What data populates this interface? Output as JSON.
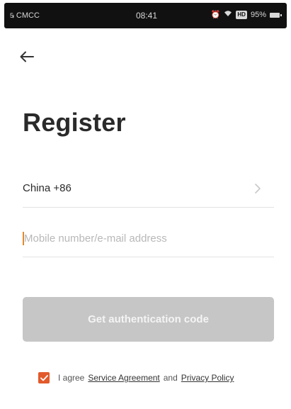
{
  "status_bar": {
    "carrier": "CMCC",
    "time": "08:41",
    "battery": "95%"
  },
  "register": {
    "title": "Register",
    "country": "China +86",
    "account_placeholder": "Mobile number/e-mail address",
    "account_value": "",
    "auth_button_label": "Get authentication code",
    "agree_prefix": "I agree",
    "service_agreement": "Service Agreement",
    "and": "and",
    "privacy_policy": "Privacy Policy",
    "agreed": true
  },
  "colors": {
    "accent": "#e25a2b",
    "disabled_button": "#c6c6c6",
    "caret": "#e08a2c"
  },
  "icons": {
    "back": "arrow-left",
    "chevron": "chevron-right",
    "checkbox": "check"
  }
}
